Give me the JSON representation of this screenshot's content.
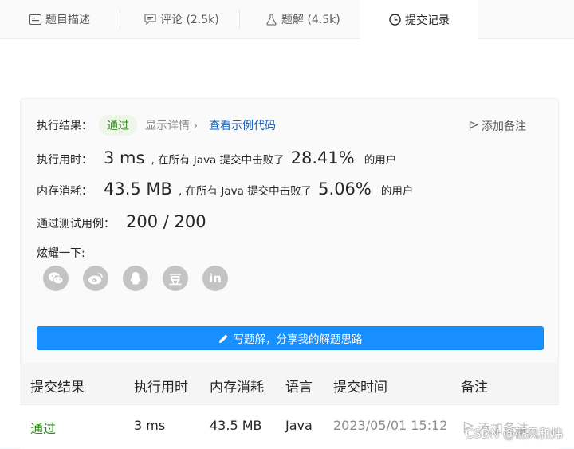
{
  "tabs": [
    {
      "label": "题目描述",
      "icon": "description-icon"
    },
    {
      "label": "评论 (2.5k)",
      "icon": "comment-icon"
    },
    {
      "label": "题解 (4.5k)",
      "icon": "flask-icon"
    },
    {
      "label": "提交记录",
      "icon": "clock-icon"
    }
  ],
  "result": {
    "label": "执行结果：",
    "status": "通过",
    "details_link": "显示详情",
    "sample_link": "查看示例代码",
    "add_note": "添加备注"
  },
  "runtime": {
    "label": "执行用时：",
    "value": "3 ms",
    "mid_text": ", 在所有 Java 提交中击败了",
    "percent": "28.41%",
    "suffix": "的用户"
  },
  "memory": {
    "label": "内存消耗：",
    "value": "43.5 MB",
    "mid_text": ", 在所有 Java 提交中击败了",
    "percent": "5.06%",
    "suffix": "的用户"
  },
  "tests": {
    "label": "通过测试用例：",
    "value": "200 / 200"
  },
  "share": {
    "label": "炫耀一下:",
    "icons": [
      "wechat-icon",
      "weibo-icon",
      "qq-icon",
      "douban-icon",
      "linkedin-icon"
    ],
    "douban_glyph": "豆",
    "linkedin_glyph": "in"
  },
  "write_solution": "写题解，分享我的解题思路",
  "table": {
    "headers": [
      "提交结果",
      "执行用时",
      "内存消耗",
      "语言",
      "提交时间",
      "备注"
    ],
    "rows": [
      {
        "result": "通过",
        "time": "3 ms",
        "memory": "43.5 MB",
        "language": "Java",
        "submitted": "2023/05/01 15:12",
        "note": "添加备注"
      }
    ]
  },
  "watermark": "CSDN @砺风和炜",
  "colors": {
    "accent": "#1890ff",
    "pass": "#2f8a1f",
    "link": "#1a5fb4"
  }
}
